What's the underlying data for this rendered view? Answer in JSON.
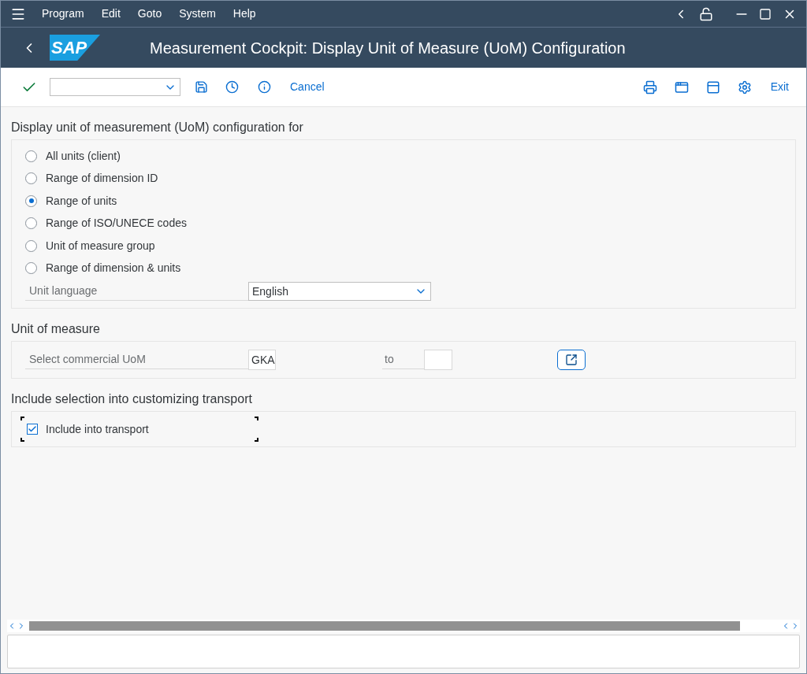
{
  "menu": [
    "Program",
    "Edit",
    "Goto",
    "System",
    "Help"
  ],
  "header": {
    "logo": "SAP",
    "title": "Measurement Cockpit: Display Unit of Measure (UoM) Configuration"
  },
  "toolbar": {
    "cancel": "Cancel",
    "exit": "Exit"
  },
  "display_section": {
    "title": "Display unit of measurement (UoM) configuration for",
    "options": [
      {
        "label": "All units (client)",
        "selected": false
      },
      {
        "label": "Range of dimension ID",
        "selected": false
      },
      {
        "label": "Range of units",
        "selected": true
      },
      {
        "label": "Range of ISO/UNECE codes",
        "selected": false
      },
      {
        "label": "Unit of measure group",
        "selected": false
      },
      {
        "label": "Range of dimension & units",
        "selected": false
      }
    ],
    "language": {
      "label": "Unit language",
      "value": "English"
    }
  },
  "uom_section": {
    "title": "Unit of measure",
    "label": "Select commercial UoM",
    "from": "GKA",
    "to_label": "to"
  },
  "transport_section": {
    "title": "Include selection into customizing transport",
    "checkbox": {
      "label": "Include into transport",
      "checked": true
    }
  }
}
